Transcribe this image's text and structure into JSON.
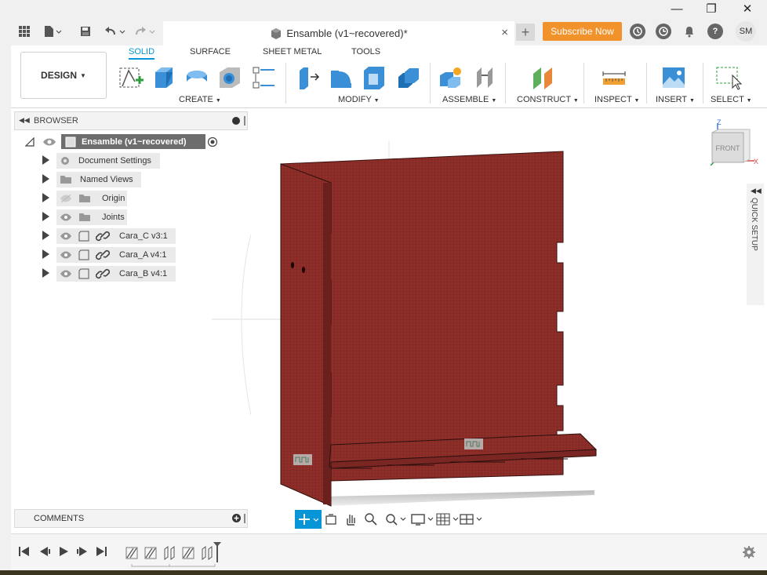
{
  "window": {
    "minimize": "—",
    "restore": "❐",
    "close": "✕"
  },
  "tabbar": {
    "doc_title": "Ensamble (v1~recovered)*",
    "close_tab": "×",
    "new_tab": "+",
    "subscribe": "Subscribe Now",
    "avatar": "SM",
    "help": "?"
  },
  "toolbar": {
    "workspace": "DESIGN",
    "tabs": [
      "SOLID",
      "SURFACE",
      "SHEET METAL",
      "TOOLS"
    ],
    "groups": [
      "CREATE",
      "MODIFY",
      "ASSEMBLE",
      "CONSTRUCT",
      "INSPECT",
      "INSERT",
      "SELECT"
    ]
  },
  "browser": {
    "title": "BROWSER",
    "root": "Ensamble (v1~recovered)",
    "items": [
      "Document Settings",
      "Named Views",
      "Origin",
      "Joints",
      "Cara_C v3:1",
      "Cara_A v4:1",
      "Cara_B v4:1"
    ]
  },
  "comments": {
    "title": "COMMENTS"
  },
  "viewcube": {
    "face": "FRONT",
    "z": "Z",
    "x": "X"
  },
  "quicksetup": {
    "label": "QUICK SETUP"
  },
  "colors": {
    "accent": "#0696d7",
    "subscribe": "#f2922b",
    "model": "#8b2e2a"
  }
}
